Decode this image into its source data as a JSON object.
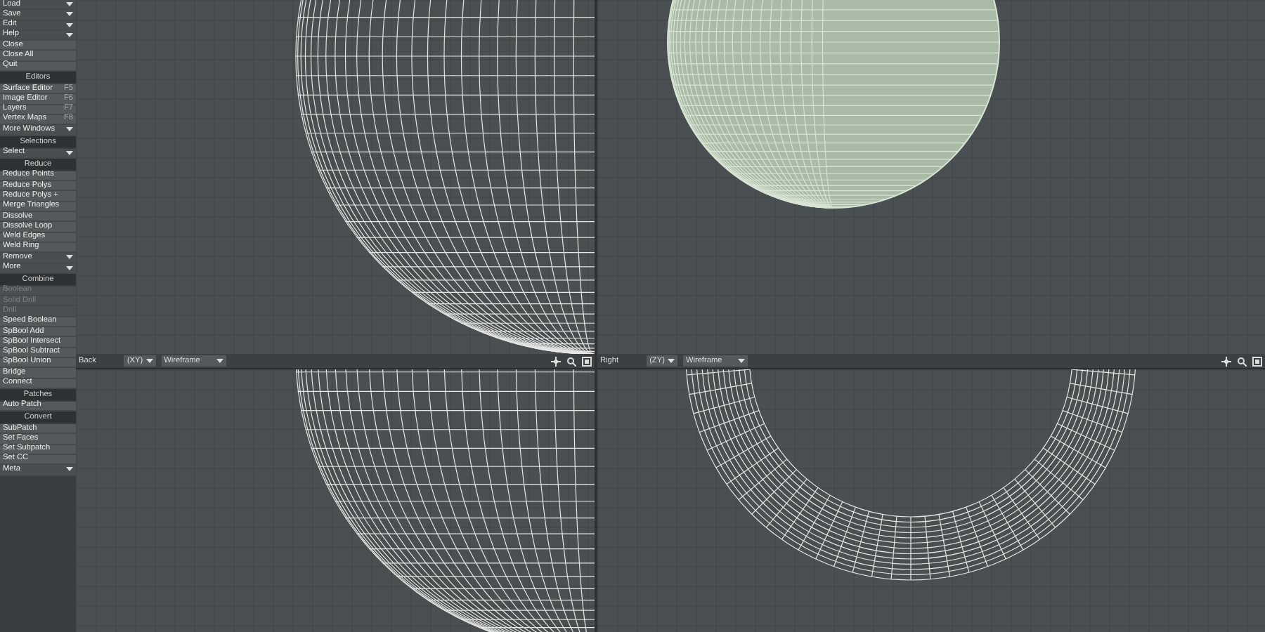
{
  "sidebar": {
    "sections": [
      {
        "items": [
          {
            "label": "Load",
            "kind": "dropdown"
          },
          {
            "label": "Save",
            "kind": "dropdown"
          },
          {
            "label": "Edit",
            "kind": "dropdown"
          },
          {
            "label": "Help",
            "kind": "dropdown"
          }
        ]
      },
      {
        "items": [
          {
            "label": "Close",
            "kind": "button"
          },
          {
            "label": "Close All",
            "kind": "button"
          },
          {
            "label": "Quit",
            "kind": "button"
          }
        ]
      },
      {
        "title": "Editors",
        "items": [
          {
            "label": "Surface Editor",
            "kind": "button",
            "shortcut": "F5"
          },
          {
            "label": "Image Editor",
            "kind": "button",
            "shortcut": "F6"
          },
          {
            "label": "Layers",
            "kind": "button",
            "shortcut": "F7"
          },
          {
            "label": "Vertex Maps",
            "kind": "button",
            "shortcut": "F8"
          }
        ]
      },
      {
        "items": [
          {
            "label": "More Windows",
            "kind": "dropdown"
          }
        ]
      },
      {
        "title": "Selections",
        "items": [
          {
            "label": "Select",
            "kind": "dropdown"
          }
        ]
      },
      {
        "title": "Reduce",
        "items": [
          {
            "label": "Reduce Points",
            "kind": "button"
          },
          {
            "label": "Reduce Polys",
            "kind": "button"
          },
          {
            "label": "Reduce Polys +",
            "kind": "button"
          },
          {
            "label": "Merge Triangles",
            "kind": "button"
          },
          {
            "label": "Dissolve",
            "kind": "button"
          },
          {
            "label": "Dissolve Loop",
            "kind": "button"
          },
          {
            "label": "Weld Edges",
            "kind": "button"
          },
          {
            "label": "Weld Ring",
            "kind": "button"
          },
          {
            "label": "Remove",
            "kind": "dropdown"
          }
        ]
      },
      {
        "items": [
          {
            "label": "More",
            "kind": "dropdown"
          }
        ]
      },
      {
        "title": "Combine",
        "items": [
          {
            "label": "Boolean",
            "kind": "button",
            "disabled": true
          },
          {
            "label": "Solid Drill",
            "kind": "button",
            "disabled": true
          },
          {
            "label": "Drill",
            "kind": "button",
            "disabled": true
          }
        ]
      },
      {
        "items": [
          {
            "label": "Speed Boolean",
            "kind": "button"
          },
          {
            "label": "SpBool Add",
            "kind": "button"
          },
          {
            "label": "SpBool Intersect",
            "kind": "button"
          },
          {
            "label": "SpBool Subtract",
            "kind": "button"
          },
          {
            "label": "SpBool Union",
            "kind": "button"
          }
        ]
      },
      {
        "items": [
          {
            "label": "Bridge",
            "kind": "button"
          },
          {
            "label": "Connect",
            "kind": "button"
          }
        ]
      },
      {
        "title": "Patches",
        "items": [
          {
            "label": "Auto Patch",
            "kind": "button"
          }
        ]
      },
      {
        "title": "Convert",
        "items": [
          {
            "label": "SubPatch",
            "kind": "button"
          },
          {
            "label": "Set Faces",
            "kind": "button"
          },
          {
            "label": "Set Subpatch",
            "kind": "button"
          },
          {
            "label": "Set CC",
            "kind": "button"
          }
        ]
      },
      {
        "items": [
          {
            "label": "Meta",
            "kind": "dropdown"
          }
        ]
      }
    ]
  },
  "viewports": [
    {
      "kind": "sphere-cut-top"
    },
    {
      "kind": "green-sphere"
    },
    {
      "kind": "sphere-cut-bottom",
      "header": {
        "name": "Back",
        "axes": "(XY)",
        "mode": "Wireframe"
      }
    },
    {
      "kind": "ring",
      "header": {
        "name": "Right",
        "axes": "(ZY)",
        "mode": "Wireframe"
      }
    }
  ]
}
